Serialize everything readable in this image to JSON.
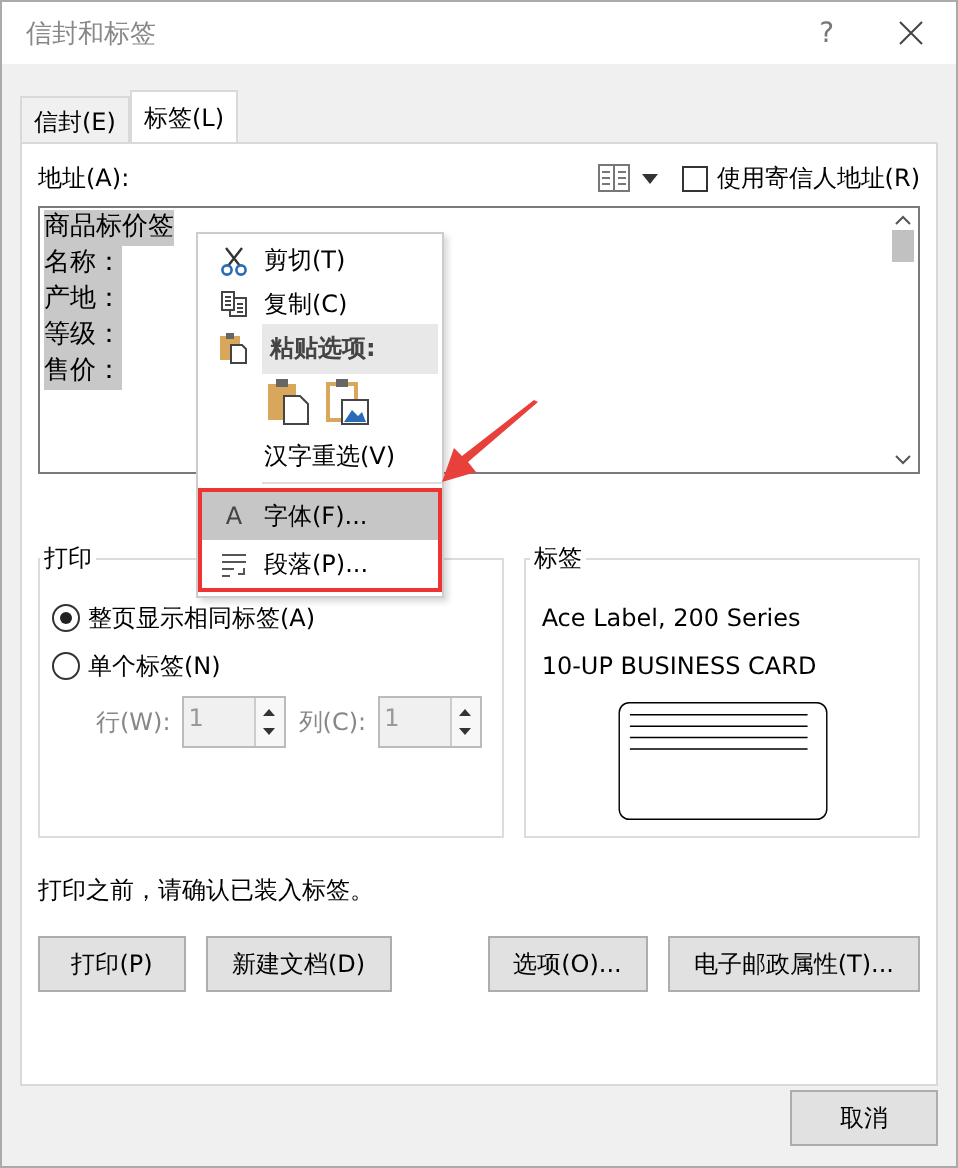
{
  "window": {
    "title": "信封和标签",
    "help": "?"
  },
  "tabs": [
    {
      "label": "信封(E)",
      "selected": false
    },
    {
      "label": "标签(L)",
      "selected": true
    }
  ],
  "address": {
    "label": "地址(A):",
    "sender_checkbox": {
      "label": "使用寄信人地址(R)",
      "checked": false
    },
    "lines": [
      {
        "text": "商品标价签",
        "selected": true
      },
      {
        "text": "名称：",
        "selected": true
      },
      {
        "text": "产地：",
        "selected": true
      },
      {
        "text": "等级：",
        "selected": true
      },
      {
        "text": "售价：",
        "selected": true
      }
    ]
  },
  "context_menu": {
    "items": [
      {
        "kind": "cut",
        "label": "剪切(T)",
        "selected": false,
        "highlighted_box": false
      },
      {
        "kind": "copy",
        "label": "复制(C)",
        "selected": false,
        "highlighted_box": false
      },
      {
        "kind": "paste_header",
        "label": "粘贴选项:"
      },
      {
        "kind": "paste_icons"
      },
      {
        "kind": "plain",
        "label": "汉字重选(V)",
        "selected": false,
        "highlighted_box": false
      },
      {
        "kind": "font",
        "icon_char": "A",
        "label": "字体(F)...",
        "selected": true,
        "highlighted_box": true
      },
      {
        "kind": "paragraph",
        "label": "段落(P)...",
        "selected": false,
        "highlighted_box": true
      }
    ]
  },
  "print_group": {
    "title": "打印",
    "options": [
      {
        "label": "整页显示相同标签(A)",
        "selected": true
      },
      {
        "label": "单个标签(N)",
        "selected": false
      }
    ],
    "fields": [
      {
        "label": "行(W):",
        "value": "1",
        "disabled": true
      },
      {
        "label": "列(C):",
        "value": "1",
        "disabled": true
      }
    ]
  },
  "label_group": {
    "title": "标签",
    "lines": [
      "Ace Label, 200 Series",
      "10-UP BUSINESS CARD"
    ]
  },
  "note": "打印之前，请确认已装入标签。",
  "buttons_left": [
    "打印(P)",
    "新建文档(D)"
  ],
  "buttons_right": [
    "选项(O)...",
    "电子邮政属性(T)..."
  ],
  "cancel": "取消"
}
